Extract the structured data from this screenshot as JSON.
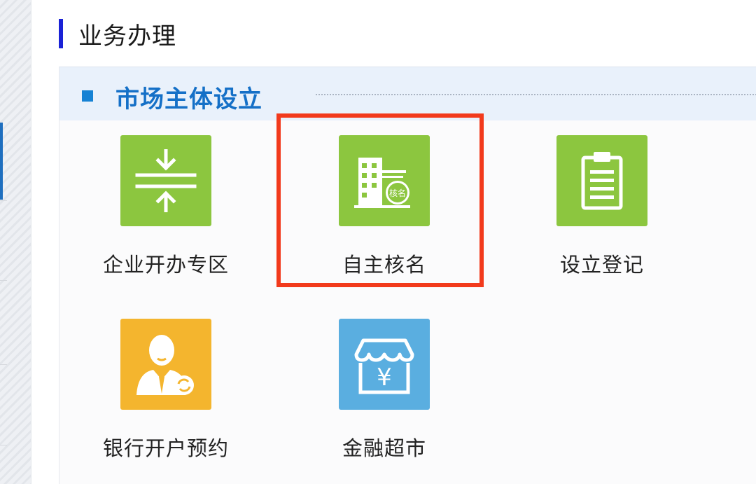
{
  "page": {
    "heading": "业务办理"
  },
  "section": {
    "title": "市场主体设立"
  },
  "tiles": [
    {
      "label": "企业开办专区",
      "color": "#8cc63f",
      "icon": "merge-arrows-icon"
    },
    {
      "label": "自主核名",
      "color": "#8cc63f",
      "icon": "building-name-check-icon",
      "badge": "核名"
    },
    {
      "label": "设立登记",
      "color": "#8cc63f",
      "icon": "clipboard-icon"
    },
    {
      "label": "银行开户预约",
      "color": "#f4b52e",
      "icon": "banker-person-icon"
    },
    {
      "label": "金融超市",
      "color": "#5aaee0",
      "icon": "shop-yen-icon",
      "symbol": "¥"
    }
  ],
  "colors": {
    "heading_bar": "#1a22d6",
    "section_title": "#1570c7",
    "highlight": "#f23a1c"
  }
}
